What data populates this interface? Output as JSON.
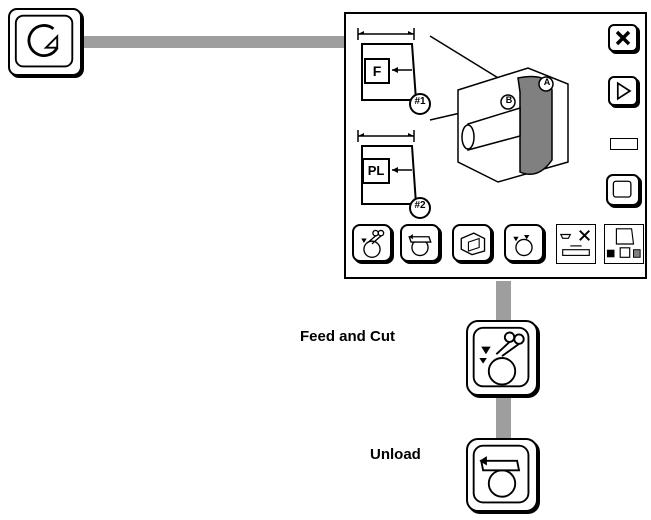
{
  "callouts": {
    "feed_and_cut": "Feed and Cut",
    "unload": "Unload"
  },
  "panel": {
    "upper_media_label": "F",
    "lower_media_label": "PL",
    "upper_spool_number": "#1",
    "lower_spool_number": "#2",
    "cutter_point_a": "A",
    "cutter_point_b": "B"
  },
  "icons": {
    "start": "rotate-arrow-icon",
    "close": "close-icon",
    "play": "play-icon",
    "status": "status-indicator",
    "page": "page-icon",
    "toolbar": [
      "feed-and-cut-icon",
      "unload-icon",
      "load-sheet-icon",
      "feed-icon",
      "cut-settings-icon",
      "media-layout-icon"
    ]
  },
  "colors": {
    "connector": "#9e9e9e",
    "outline": "#000000",
    "cutter_shade": "#808080"
  }
}
